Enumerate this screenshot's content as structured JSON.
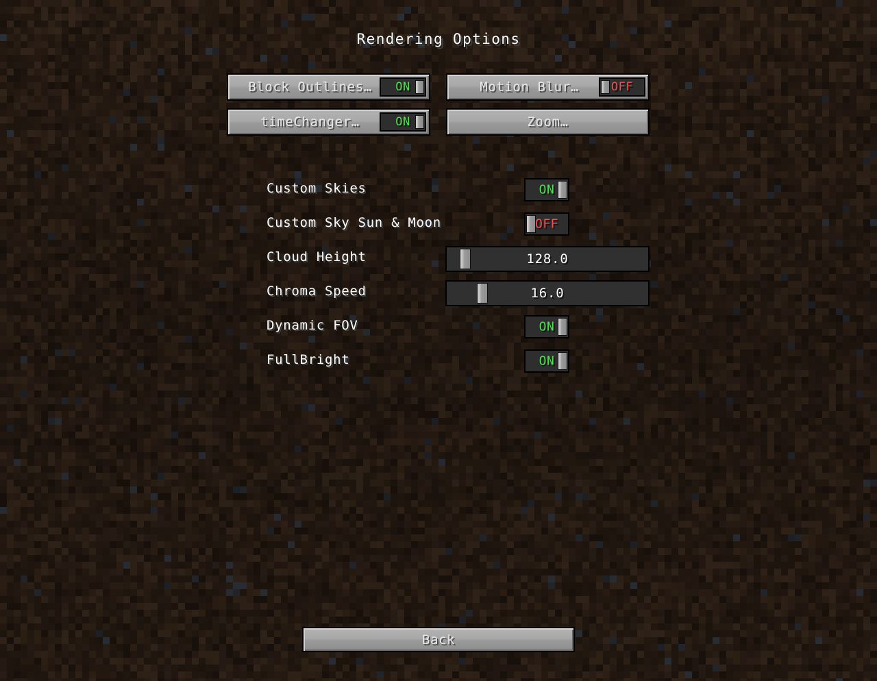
{
  "screen": {
    "title": "Rendering Options",
    "background_color": "#2b1d13",
    "accent_on_color": "#4ee04e",
    "accent_off_color": "#f25050",
    "text_color": "#ffffff"
  },
  "top_buttons": [
    {
      "label": "Block Outlines…",
      "toggle": {
        "state": "ON",
        "on": true
      }
    },
    {
      "label": "Motion Blur…",
      "toggle": {
        "state": "OFF",
        "on": false
      }
    },
    {
      "label": "timeChanger…",
      "toggle": {
        "state": "ON",
        "on": true
      }
    },
    {
      "label": "Zoom…",
      "toggle": null
    }
  ],
  "options": [
    {
      "label": "Custom Skies",
      "type": "toggle",
      "state": "ON",
      "on": true
    },
    {
      "label": "Custom Sky Sun & Moon",
      "type": "toggle",
      "state": "OFF",
      "on": false
    },
    {
      "label": "Cloud Height",
      "type": "slider",
      "value": "128.0",
      "knob_percent": 7
    },
    {
      "label": "Chroma Speed",
      "type": "slider",
      "value": "16.0",
      "knob_percent": 16
    },
    {
      "label": "Dynamic FOV",
      "type": "toggle",
      "state": "ON",
      "on": true
    },
    {
      "label": "FullBright",
      "type": "toggle",
      "state": "ON",
      "on": true
    }
  ],
  "footer": {
    "back_label": "Back"
  }
}
